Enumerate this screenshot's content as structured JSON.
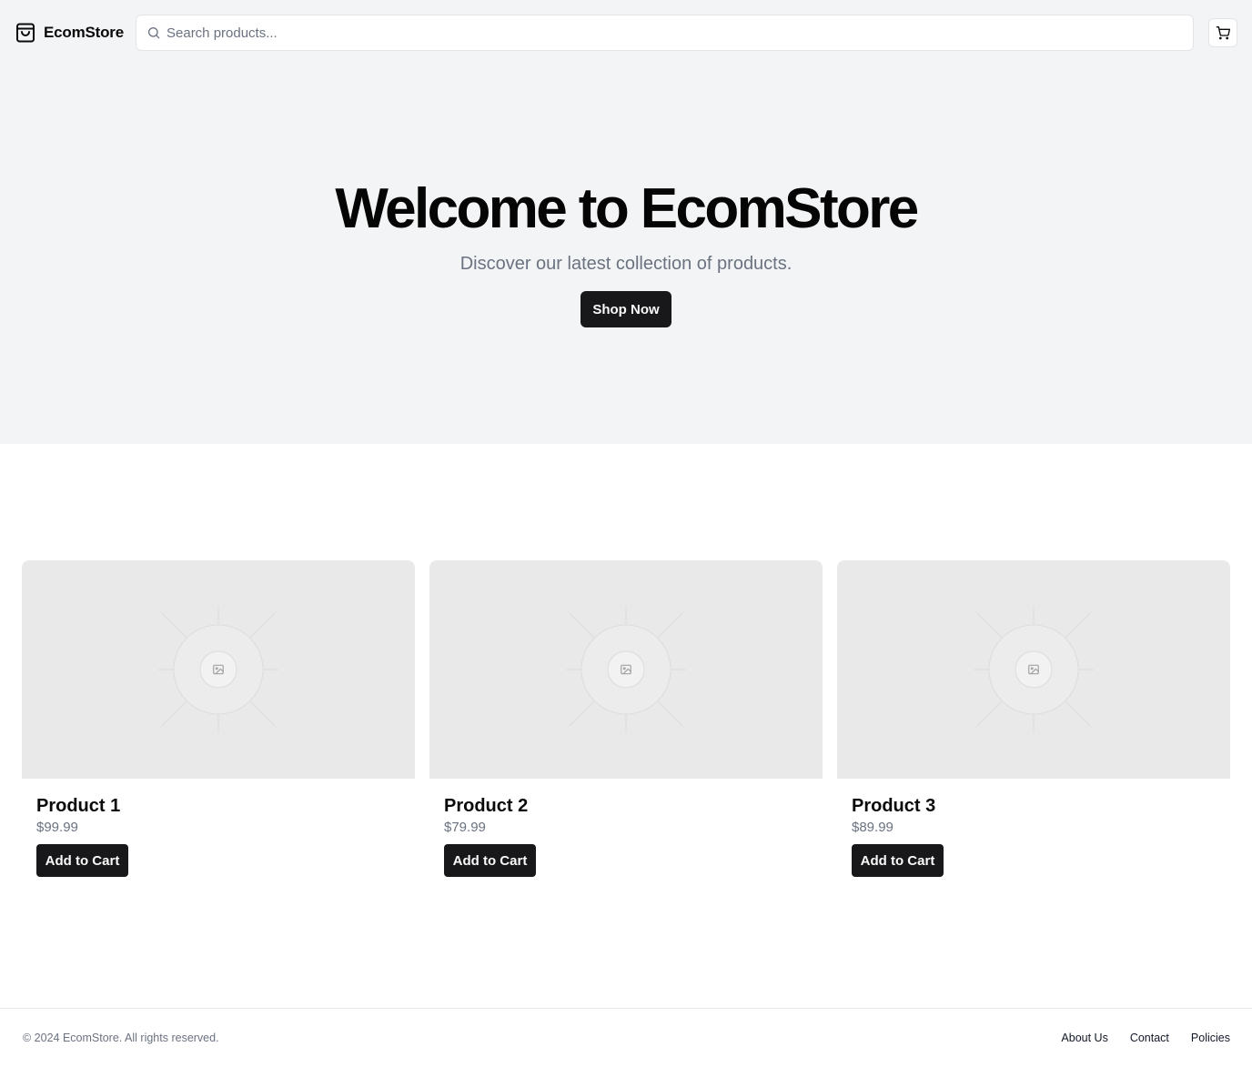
{
  "header": {
    "brand_name": "EcomStore",
    "brand_icon": "shopping-bag-icon",
    "search_placeholder": "Search products...",
    "search_value": "",
    "cart_icon": "shopping-cart-icon"
  },
  "hero": {
    "title": "Welcome to EcomStore",
    "subtitle": "Discover our latest collection of products.",
    "cta_label": "Shop Now"
  },
  "products": [
    {
      "name": "Product 1",
      "price": "$99.99",
      "button_label": "Add to Cart",
      "image_icon": "image-placeholder-icon"
    },
    {
      "name": "Product 2",
      "price": "$79.99",
      "button_label": "Add to Cart",
      "image_icon": "image-placeholder-icon"
    },
    {
      "name": "Product 3",
      "price": "$89.99",
      "button_label": "Add to Cart",
      "image_icon": "image-placeholder-icon"
    }
  ],
  "footer": {
    "copyright": "© 2024 EcomStore. All rights reserved.",
    "links": [
      "About Us",
      "Contact",
      "Policies"
    ]
  },
  "colors": {
    "header_bg": "#f3f4f6",
    "primary_button": "#18181b",
    "muted_text": "#6b7280",
    "placeholder_bg": "#e9e9e9"
  }
}
